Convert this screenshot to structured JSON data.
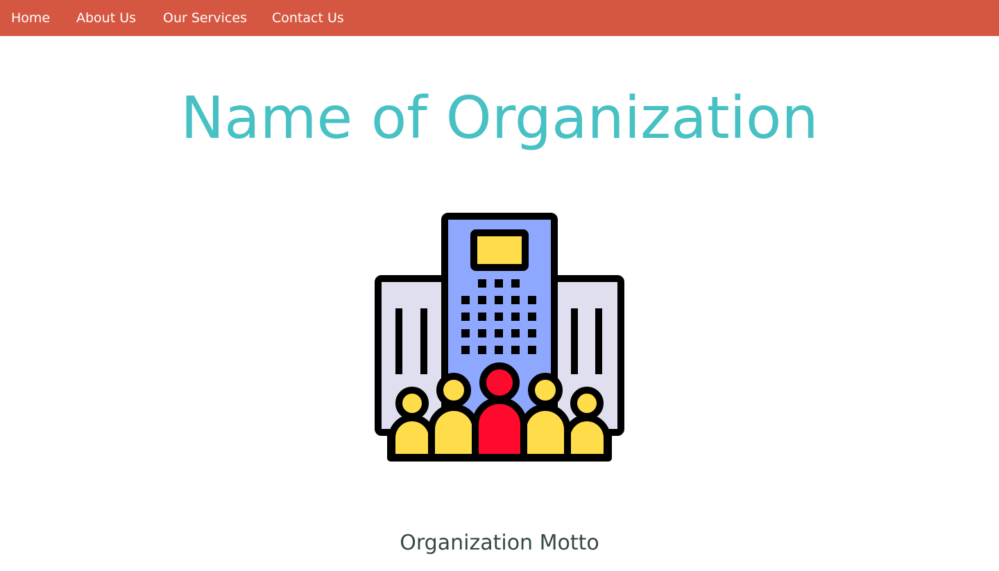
{
  "nav": {
    "items": [
      {
        "label": "Home"
      },
      {
        "label": "About Us"
      },
      {
        "label": "Our Services"
      },
      {
        "label": "Contact Us"
      }
    ]
  },
  "hero": {
    "title": "Name of Organization",
    "logo_icon": "organization-building-people-icon",
    "motto": "Organization Motto"
  },
  "colors": {
    "nav_background": "#d65741",
    "nav_text": "#ffffff",
    "title": "#47c1c4",
    "motto": "#354845",
    "tower_fill": "#8fa8ff",
    "side_building_fill": "#e0dff0",
    "person_yellow": "#ffdd4a",
    "person_red": "#ff0a2c",
    "outline": "#000000"
  }
}
